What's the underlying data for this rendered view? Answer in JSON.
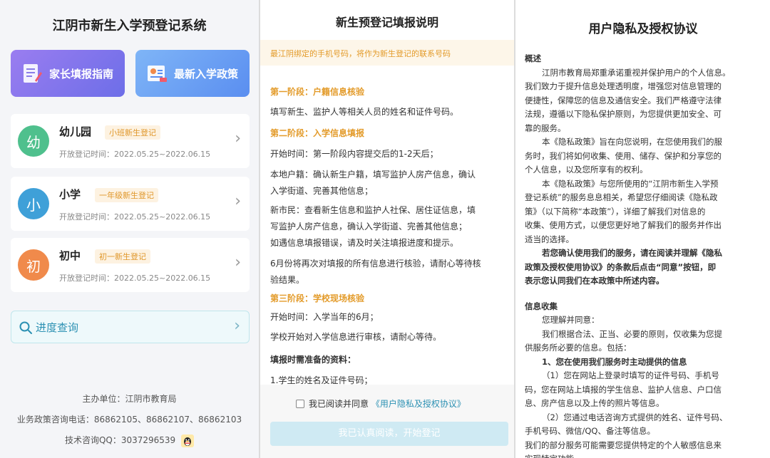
{
  "left_panel": {
    "title": "江阴市新生入学预登记系统",
    "guide_button": "家长填报指南",
    "policy_button": "最新入学政策",
    "cards": [
      {
        "badge": "幼",
        "name": "幼儿园",
        "tag": "小班新生登记",
        "time": "开放登记时间：2022.05.25~2022.06.15",
        "color": "#4fc08d"
      },
      {
        "badge": "小",
        "name": "小学",
        "tag": "一年级新生登记",
        "time": "开放登记时间：2022.05.25~2022.06.15",
        "color": "#3fa0d8"
      },
      {
        "badge": "初",
        "name": "初中",
        "tag": "初一新生登记",
        "time": "开放登记时间：2022.05.25~2022.06.15",
        "color": "#f08a4b"
      }
    ],
    "progress_query": "进度查询",
    "footer": {
      "host": "主办单位：江阴市教育局",
      "phone": "业务政策咨询电话：86862105、86862107、86862103",
      "qq": "技术咨询QQ：3037296539"
    }
  },
  "middle_panel": {
    "title": "新生预登记填报说明",
    "notice": "最江阴绑定的手机号码，将作为新生登记的联系号码",
    "lines": [
      {
        "text": "第一阶段：户籍信息核验",
        "kind": "stage"
      },
      {
        "text": "填写新生、监护人等相关人员的姓名和证件号码。",
        "kind": "normal"
      },
      {
        "text": "第二阶段：入学信息填报",
        "kind": "stage"
      },
      {
        "text": "开始时间：第一阶段内容提交后的1-2天后；",
        "kind": "normal"
      },
      {
        "text": "本地户籍：确认新生户籍，填写监护人房产信息，确认",
        "kind": "normal"
      },
      {
        "text": "入学街道、完善其他信息；",
        "kind": "normal"
      },
      {
        "text": "新市民：查看新生信息和监护人社保、居住证信息，填",
        "kind": "normal"
      },
      {
        "text": "写监护人房产信息，确认入学街道、完善其他信息；",
        "kind": "normal"
      },
      {
        "text": "如遇信息填报错误，请及时关注填报进度和提示。",
        "kind": "normal"
      },
      {
        "text": "6月份将再次对填报的所有信息进行核验，请耐心等待核",
        "kind": "normal"
      },
      {
        "text": "验结果。",
        "kind": "normal"
      },
      {
        "text": "第三阶段：学校现场核验",
        "kind": "stage"
      },
      {
        "text": "开始时间：入学当年的6月；",
        "kind": "normal"
      },
      {
        "text": "学校开始对入学信息进行审核，请耐心等待。",
        "kind": "normal"
      },
      {
        "text": "填报时需准备的资料：",
        "kind": "bold"
      },
      {
        "text": "1.学生的姓名及证件号码；",
        "kind": "normal"
      }
    ],
    "agree_prefix": "我已阅读并同意",
    "agree_link": "《用户隐私及授权协议》",
    "submit": "我已认真阅读，开始登记"
  },
  "right_panel": {
    "title": "用户隐私及授权协议",
    "lines": [
      {
        "text": "概述",
        "kind": "h",
        "indent": 0
      },
      {
        "text": "江阴市教育局郑重承诺重视并保护用户的个人信息。",
        "kind": "n",
        "indent": 24
      },
      {
        "text": "我们致力于提升信息处理透明度，增强您对信息管理的",
        "kind": "n",
        "indent": 0
      },
      {
        "text": "便捷性，保障您的信息及通信安全。我们严格遵守法律",
        "kind": "n",
        "indent": 0
      },
      {
        "text": "法规，遵循以下隐私保护原则，为您提供更加安全、可",
        "kind": "n",
        "indent": 0
      },
      {
        "text": "靠的服务。",
        "kind": "n",
        "indent": 0
      },
      {
        "text": "本《隐私政策》旨在向您说明，在您使用我们的服",
        "kind": "n",
        "indent": 24
      },
      {
        "text": "务时，我们将如何收集、使用、储存、保护和分享您的",
        "kind": "n",
        "indent": 0
      },
      {
        "text": "个人信息，以及您所享有的权利。",
        "kind": "n",
        "indent": 0
      },
      {
        "text": "本《隐私政策》与您所使用的“江阴市新生入学预",
        "kind": "n",
        "indent": 24
      },
      {
        "text": "登记系统”的服务息息相关，希望您仔细阅读《隐私政",
        "kind": "n",
        "indent": 0
      },
      {
        "text": "策》（以下简称“本政策”），详细了解我们对信息的",
        "kind": "n",
        "indent": 0
      },
      {
        "text": "收集、使用方式，以便您更好地了解我们的服务并作出",
        "kind": "n",
        "indent": 0
      },
      {
        "text": "适当的选择。",
        "kind": "n",
        "indent": 0
      },
      {
        "text": "若您确认使用我们的服务，请在阅读并理解《隐私",
        "kind": "b",
        "indent": 24
      },
      {
        "text": "政策及授权使用协议》的条款后点击“同意”按钮，即",
        "kind": "b",
        "indent": 0
      },
      {
        "text": "表示您认同我们在本政策中所述内容。",
        "kind": "b",
        "indent": 0
      },
      {
        "text": "信息收集",
        "kind": "h",
        "indent": 0,
        "gap": 16
      },
      {
        "text": "您理解并同意：",
        "kind": "n",
        "indent": 24
      },
      {
        "text": "我们根据合法、正当、必要的原则，仅收集为您提",
        "kind": "n",
        "indent": 24
      },
      {
        "text": "供服务所必要的信息。包括：",
        "kind": "n",
        "indent": 0
      },
      {
        "text": "1、您在使用我们服务时主动提供的信息",
        "kind": "b",
        "indent": 24
      },
      {
        "text": "（1）您在网站上登录时填写的证件号码、手机号",
        "kind": "n",
        "indent": 24
      },
      {
        "text": "码，您在网站上填报的学生信息、监护人信息、户口信",
        "kind": "n",
        "indent": 0
      },
      {
        "text": "息、房产信息以及上传的照片等信息。",
        "kind": "n",
        "indent": 0
      },
      {
        "text": "（2）您通过电话咨询方式提供的姓名、证件号码、",
        "kind": "n",
        "indent": 24
      },
      {
        "text": "手机号码、微信/QQ、备注等信息。",
        "kind": "n",
        "indent": 0
      },
      {
        "text": "我们的部分服务可能需要您提供特定的个人敏感信息来",
        "kind": "n",
        "indent": 0
      },
      {
        "text": "实现特定功能",
        "kind": "n",
        "indent": 0
      }
    ]
  }
}
